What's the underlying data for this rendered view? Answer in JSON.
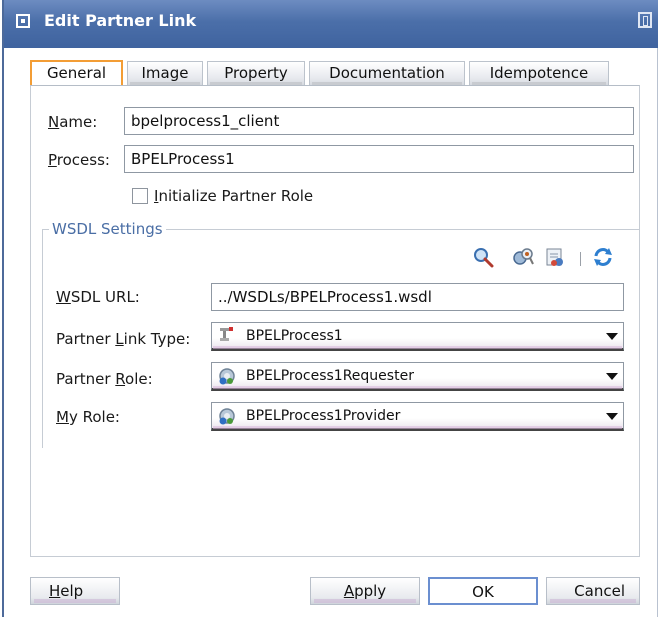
{
  "window": {
    "title": "Edit Partner Link"
  },
  "tabs": [
    {
      "label": "General",
      "active": true
    },
    {
      "label": "Image",
      "active": false
    },
    {
      "label": "Property",
      "active": false
    },
    {
      "label": "Documentation",
      "active": false
    },
    {
      "label": "Idempotence",
      "active": false
    }
  ],
  "general": {
    "name_label_mn": "N",
    "name_label_rest": "ame:",
    "name_value": "bpelprocess1_client",
    "process_label_mn": "P",
    "process_label_rest": "rocess:",
    "process_value": "BPELProcess1",
    "init_role_label_mn": "I",
    "init_role_label_rest": "nitialize Partner Role",
    "init_role_checked": false
  },
  "wsdl": {
    "legend": "WSDL Settings",
    "toolbar_icons": [
      "search-icon",
      "service-explorer-icon",
      "create-wsdl-icon",
      "refresh-icon"
    ],
    "url_label_mn": "W",
    "url_label_rest": "SDL URL:",
    "url_value": "../WSDLs/BPELProcess1.wsdl",
    "plt_label_pre": "Partner ",
    "plt_label_mn": "L",
    "plt_label_rest": "ink Type:",
    "plt_value": "BPELProcess1",
    "prole_label_pre": "Partner ",
    "prole_label_mn": "R",
    "prole_label_rest": "ole:",
    "prole_value": "BPELProcess1Requester",
    "myrole_label_mn": "M",
    "myrole_label_rest": "y Role:",
    "myrole_value": "BPELProcess1Provider"
  },
  "buttons": {
    "help_mn": "H",
    "help_rest": "elp",
    "apply_mn": "A",
    "apply_rest": "pply",
    "ok": "OK",
    "cancel": "Cancel"
  },
  "colors": {
    "titlebar": "#4b6fa9",
    "active_tab_border": "#f39d35",
    "legend_text": "#4a6ea5"
  }
}
